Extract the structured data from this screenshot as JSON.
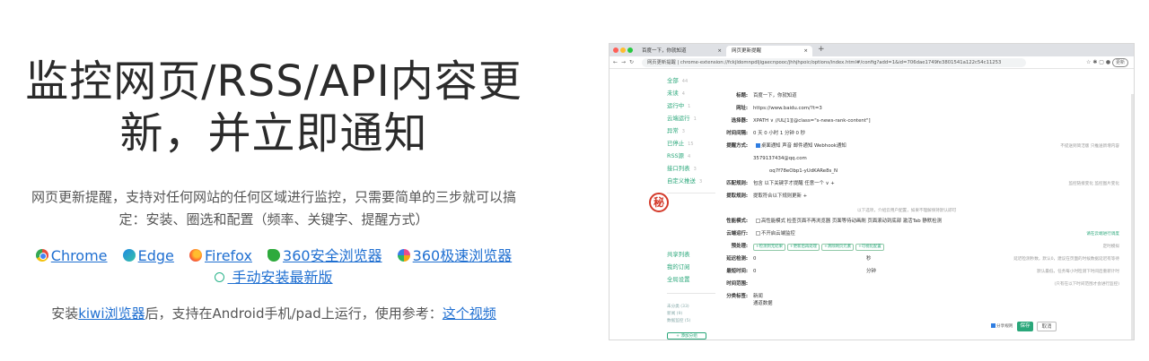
{
  "hero": {
    "title_line1": "监控网页/RSS/API内容更",
    "title_line2": "新，并立即通知",
    "subtitle_line1": "网页更新提醒，支持对任何网站的任何区域进行监控，只需要简单的三步就可以搞",
    "subtitle_line2": "定：安装、圈选和配置（频率、关键字、提醒方式）"
  },
  "browsers": [
    {
      "label": "Chrome",
      "icon": "chrome-icon"
    },
    {
      "label": "Edge",
      "icon": "edge-icon"
    },
    {
      "label": "Firefox",
      "icon": "firefox-icon"
    },
    {
      "label": "360安全浏览器",
      "icon": "360-safe-browser-icon"
    },
    {
      "label": "360极速浏览器",
      "icon": "360-speed-browser-icon"
    }
  ],
  "manual_install": "手动安装最新版",
  "install_note": {
    "prefix": "安装",
    "kiwi_link": "kiwi浏览器",
    "middle": "后，支持在Android手机/pad上运行，使用参考：",
    "video_link": "这个视频"
  },
  "screenshot": {
    "tab1": "百度一下，你就知道",
    "tab2": "网页更新提醒",
    "url": "网页更新提醒 | chrome-extension://fckjldomnpdljigaecnpooc/jhhjhpoic/options/index.html#/config?add=1&id=706dae1749fe3801541a122c54c11253",
    "update_btn": "更新",
    "sidebar": [
      {
        "label": "全部",
        "count": "44"
      },
      {
        "label": "未读",
        "count": "4"
      },
      {
        "label": "运行中",
        "count": "1"
      },
      {
        "label": "云端运行",
        "count": "1"
      },
      {
        "label": "异常",
        "count": "3"
      },
      {
        "label": "已停止",
        "count": "15"
      },
      {
        "label": "RSS源",
        "count": "4"
      },
      {
        "label": "接口列表",
        "count": "3"
      },
      {
        "label": "自定义推送",
        "count": "3"
      }
    ],
    "sidebar2": [
      "共享列表",
      "我的订阅",
      "全局设置"
    ],
    "sidebar_mini": [
      "未分类 (33)",
      "新闻 (9)",
      "数据监控 (5)",
      "网站更新 (3)"
    ],
    "add_category": "+ 添加分组",
    "form": {
      "title_label": "标题:",
      "title_value": "百度一下，你就知道",
      "url_label": "网址:",
      "url_value": "https://www.baidu.com/?t=3",
      "selector_label": "选择器:",
      "selector_value": "XPATH ∨  //UL[1][@class=\"s-news-rank-content\"]",
      "interval_label": "时间间隔:",
      "interval_value": "0  天  0  小时  1  分钟  0  秒",
      "notify_label": "提醒方式:",
      "notify_value": "桌面通知  声音  邮件通知  Webhook通知",
      "notify_right": "不提送到简洁版  只推送新增内容",
      "email_value": "3579137434@qq.com",
      "webhook_value": "oq7f78eObp1-yUdKARe8s_N",
      "match_label": "匹配规则:",
      "match_value": "包含   以下关键字才提醒   任意一个 ∨  +",
      "match_right": "监控链接变化  监控图片变化",
      "rule_label": "提取规则:",
      "rule_value": "提取符合以下规则更新  +",
      "center_note": "以下选项，介绍云用户配置，如果不理解保持默认即可",
      "perf_label": "性能模式:",
      "perf_value": "高性能模式  检查页面不再浏览器  页面等待动画刷  页面滚动到底部  激活Tab  静默检测",
      "cloud_label": "云端运行:",
      "cloud_value": "不开启云端监控",
      "cloud_right": "请在云端进行调度",
      "pre_label": "预处理:",
      "pre_pills": [
        "+检测到无结果",
        "+更新后再处理",
        "+清除网页元素",
        "+可视化配置"
      ],
      "pre_right": "定时模拟",
      "delay_label": "延迟检测:",
      "delay_value": "0",
      "delay_unit": "秒",
      "delay_hint": "延迟检测秒数，默认0，建议在页面的时候数据延迟有等待",
      "max_label": "最短时间:",
      "max_value": "0",
      "max_unit": "分钟",
      "max_hint": "默认最低，任务每小时检测下时间后重新计时",
      "range_label": "时间范围:",
      "range_hint": "(只有在以下时间范围才会进行监控)",
      "tag_label": "分类标签:",
      "tag_value1": "新闻",
      "tag_value2": "通道数据",
      "share_label": "分享规则",
      "save": "保存",
      "cancel": "取消"
    }
  }
}
